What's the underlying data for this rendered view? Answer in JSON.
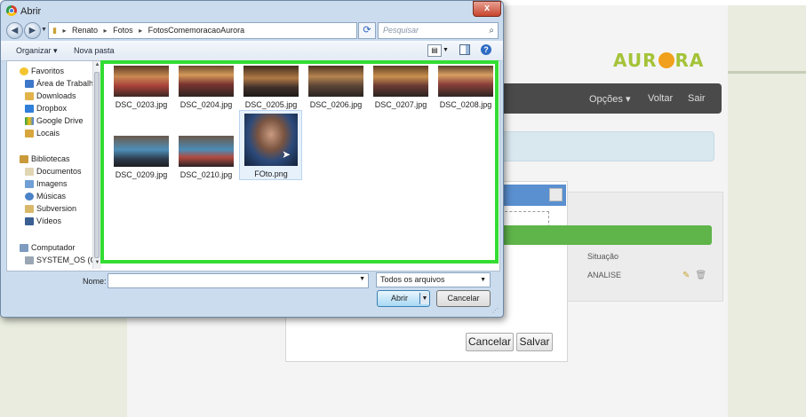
{
  "dialog": {
    "title": "Abrir",
    "close_label": "x",
    "address": {
      "crumbs": [
        "Renato",
        "Fotos",
        "FotosComemoracaoAurora"
      ],
      "separator": "▸"
    },
    "search_placeholder": "Pesquisar FotosComemoracao...",
    "toolbar": {
      "organize_label": "Organizar ▾",
      "new_folder_label": "Nova pasta",
      "help_label": "?"
    },
    "nav": {
      "favorites_header": "Favoritos",
      "favorites": [
        "Área de Trabalho",
        "Downloads",
        "Dropbox",
        "Google Drive",
        "Locais"
      ],
      "libraries_header": "Bibliotecas",
      "libraries": [
        "Documentos",
        "Imagens",
        "Músicas",
        "Subversion",
        "Vídeos"
      ],
      "computer_header": "Computador",
      "computer": [
        "SYSTEM_OS (C:)"
      ]
    },
    "files": [
      {
        "name": "DSC_0203.jpg"
      },
      {
        "name": "DSC_0204.jpg"
      },
      {
        "name": "DSC_0205.jpg"
      },
      {
        "name": "DSC_0206.jpg"
      },
      {
        "name": "DSC_0207.jpg"
      },
      {
        "name": "DSC_0208.jpg"
      },
      {
        "name": "DSC_0209.jpg"
      },
      {
        "name": "DSC_0210.jpg"
      },
      {
        "name": "FOto.png"
      }
    ],
    "selected_file": "FOto.png",
    "name_label": "Nome:",
    "name_value": "",
    "file_type": "Todos os arquivos",
    "open_label": "Abrir",
    "cancel_label": "Cancelar"
  },
  "background": {
    "logo_left": "AUR",
    "logo_right": "RA",
    "nav": {
      "options": "Opções ▾",
      "back": "Voltar",
      "exit": "Sair"
    },
    "table_header": "Situação",
    "table_status": "ANALISE",
    "modal_cancel": "Cancelar",
    "modal_save": "Salvar"
  },
  "colors": {
    "highlight_frame": "#33dd33",
    "navbar": "#4a4a4a",
    "green_bar": "#5fb44a",
    "logo": "#a4c338",
    "dialog_frame": "#cbdcee"
  }
}
